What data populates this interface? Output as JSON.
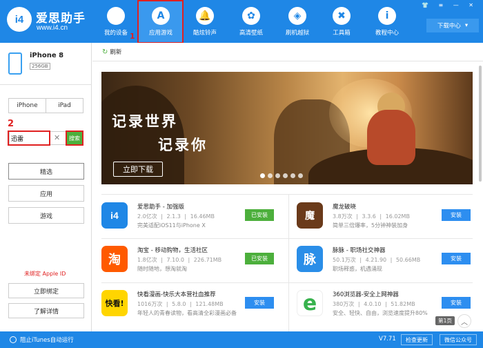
{
  "brand": {
    "name": "爱思助手",
    "url": "www.i4.cn",
    "logo_text": "i4"
  },
  "nav": [
    {
      "label": "我的设备",
      "icon": "apple-icon",
      "glyph": ""
    },
    {
      "label": "应用游戏",
      "icon": "app-store-icon",
      "glyph": "A"
    },
    {
      "label": "酷炫铃声",
      "icon": "bell-icon",
      "glyph": "🔔"
    },
    {
      "label": "高清壁纸",
      "icon": "flower-icon",
      "glyph": "✿"
    },
    {
      "label": "刷机越狱",
      "icon": "dropbox-icon",
      "glyph": "◈"
    },
    {
      "label": "工具箱",
      "icon": "tools-icon",
      "glyph": "✖"
    },
    {
      "label": "教程中心",
      "icon": "info-icon",
      "glyph": "i"
    }
  ],
  "annotations": {
    "n1": "1",
    "n2": "2"
  },
  "download_center": {
    "label": "下载中心",
    "arrow": "▾"
  },
  "window_controls": "👕 ≡ — ✕",
  "device": {
    "name": "iPhone 8",
    "capacity": "256GB"
  },
  "device_tabs": {
    "iphone": "iPhone",
    "ipad": "iPad"
  },
  "search": {
    "value": "迅雷",
    "clear": "✕",
    "button": "搜索"
  },
  "categories": {
    "featured": "精选",
    "apps": "应用",
    "games": "游戏"
  },
  "apple_id": {
    "status": "未绑定 Apple ID",
    "bind": "立即绑定",
    "details": "了解详情"
  },
  "refresh": {
    "label": "刷新",
    "icon": "↻"
  },
  "banner": {
    "line1": "记录世界",
    "line2": "记录你",
    "button": "立即下载",
    "slides": 6
  },
  "apps": [
    {
      "name": "爱思助手 - 加强版",
      "downloads": "2.0亿次",
      "version": "2.1.3",
      "size": "16.46MB",
      "desc": "完美适配iOS11与iPhone X",
      "button": "已安装",
      "icon_text": "i4",
      "color": "#1f87e6"
    },
    {
      "name": "魔龙破晓",
      "downloads": "3.8万次",
      "version": "3.3.6",
      "size": "16.02MB",
      "desc": "简单三倍爆率，5分钟神装加身",
      "button": "安装",
      "icon_text": "魔",
      "color": "#6a3a1a"
    },
    {
      "name": "淘宝 - 移动购物，生活社区",
      "downloads": "1.8亿次",
      "version": "7.10.0",
      "size": "226.71MB",
      "desc": "随时随地，想淘就淘",
      "button": "已安装",
      "icon_text": "淘",
      "color": "#ff5a00"
    },
    {
      "name": "脉脉 - 职场社交神器",
      "downloads": "50.1万次",
      "version": "4.21.90",
      "size": "50.66MB",
      "desc": "职场释惑，机遇涌现",
      "button": "安装",
      "icon_text": "脉",
      "color": "#2a8ee8"
    },
    {
      "name": "快看漫画-快乐大本营社血推荐",
      "downloads": "1016万次",
      "version": "5.8.0",
      "size": "121.48MB",
      "desc": "年轻人的青春读物，看高清全彩漫画必备",
      "button": "安装",
      "icon_text": "快看!",
      "color": "#ffd500"
    },
    {
      "name": "360浏览器-安全上网神器",
      "downloads": "380万次",
      "version": "4.0.10",
      "size": "51.82MB",
      "desc": "安全、轻快、自由，浏览速度提升80%",
      "button": "安装",
      "icon_text": "e",
      "color": "#ffffff"
    }
  ],
  "pager": {
    "page": "第1页",
    "up": "︿"
  },
  "footer": {
    "itunes": "阻止iTunes自动运行",
    "version": "V7.71",
    "update": "检查更新",
    "wechat": "微信公众号"
  }
}
